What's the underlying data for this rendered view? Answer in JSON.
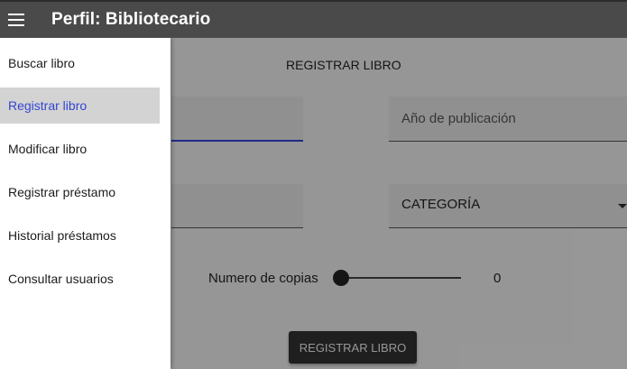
{
  "appbar": {
    "menu_icon": "hamburger-menu-icon",
    "title": "Perfil: Bibliotecario"
  },
  "form": {
    "heading": "REGISTRAR LIBRO",
    "title_value": "",
    "year_placeholder": "Año de publicación",
    "author_value": "",
    "category_label": "CATEGORÍA",
    "copies_label": "Numero de copias",
    "copies_value": "0",
    "copies_fraction": 0,
    "submit_label": "REGISTRAR LIBRO"
  },
  "drawer": {
    "items": [
      {
        "label": "Buscar libro"
      },
      {
        "label": "Registrar libro",
        "selected": true
      },
      {
        "label": "Modificar libro"
      },
      {
        "label": "Registrar préstamo"
      },
      {
        "label": "Historial préstamos"
      },
      {
        "label": "Consultar usuarios"
      }
    ]
  },
  "colors": {
    "appbar": "#4a4a4a",
    "accent": "#3446d4",
    "selected_bg": "#d3d3d3"
  }
}
